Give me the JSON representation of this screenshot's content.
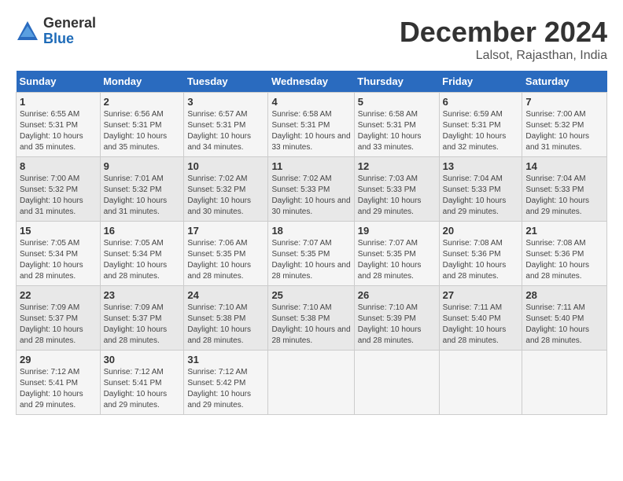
{
  "header": {
    "logo_general": "General",
    "logo_blue": "Blue",
    "month_title": "December 2024",
    "location": "Lalsot, Rajasthan, India"
  },
  "calendar": {
    "days_header": [
      "Sunday",
      "Monday",
      "Tuesday",
      "Wednesday",
      "Thursday",
      "Friday",
      "Saturday"
    ],
    "weeks": [
      [
        null,
        null,
        null,
        null,
        null,
        null,
        null
      ]
    ],
    "cells": [
      {
        "date": 1,
        "sunrise": "6:55 AM",
        "sunset": "5:31 PM",
        "daylight": "10 hours and 35 minutes."
      },
      {
        "date": 2,
        "sunrise": "6:56 AM",
        "sunset": "5:31 PM",
        "daylight": "10 hours and 35 minutes."
      },
      {
        "date": 3,
        "sunrise": "6:57 AM",
        "sunset": "5:31 PM",
        "daylight": "10 hours and 34 minutes."
      },
      {
        "date": 4,
        "sunrise": "6:58 AM",
        "sunset": "5:31 PM",
        "daylight": "10 hours and 33 minutes."
      },
      {
        "date": 5,
        "sunrise": "6:58 AM",
        "sunset": "5:31 PM",
        "daylight": "10 hours and 33 minutes."
      },
      {
        "date": 6,
        "sunrise": "6:59 AM",
        "sunset": "5:31 PM",
        "daylight": "10 hours and 32 minutes."
      },
      {
        "date": 7,
        "sunrise": "7:00 AM",
        "sunset": "5:32 PM",
        "daylight": "10 hours and 31 minutes."
      },
      {
        "date": 8,
        "sunrise": "7:00 AM",
        "sunset": "5:32 PM",
        "daylight": "10 hours and 31 minutes."
      },
      {
        "date": 9,
        "sunrise": "7:01 AM",
        "sunset": "5:32 PM",
        "daylight": "10 hours and 31 minutes."
      },
      {
        "date": 10,
        "sunrise": "7:02 AM",
        "sunset": "5:32 PM",
        "daylight": "10 hours and 30 minutes."
      },
      {
        "date": 11,
        "sunrise": "7:02 AM",
        "sunset": "5:33 PM",
        "daylight": "10 hours and 30 minutes."
      },
      {
        "date": 12,
        "sunrise": "7:03 AM",
        "sunset": "5:33 PM",
        "daylight": "10 hours and 29 minutes."
      },
      {
        "date": 13,
        "sunrise": "7:04 AM",
        "sunset": "5:33 PM",
        "daylight": "10 hours and 29 minutes."
      },
      {
        "date": 14,
        "sunrise": "7:04 AM",
        "sunset": "5:33 PM",
        "daylight": "10 hours and 29 minutes."
      },
      {
        "date": 15,
        "sunrise": "7:05 AM",
        "sunset": "5:34 PM",
        "daylight": "10 hours and 28 minutes."
      },
      {
        "date": 16,
        "sunrise": "7:05 AM",
        "sunset": "5:34 PM",
        "daylight": "10 hours and 28 minutes."
      },
      {
        "date": 17,
        "sunrise": "7:06 AM",
        "sunset": "5:35 PM",
        "daylight": "10 hours and 28 minutes."
      },
      {
        "date": 18,
        "sunrise": "7:07 AM",
        "sunset": "5:35 PM",
        "daylight": "10 hours and 28 minutes."
      },
      {
        "date": 19,
        "sunrise": "7:07 AM",
        "sunset": "5:35 PM",
        "daylight": "10 hours and 28 minutes."
      },
      {
        "date": 20,
        "sunrise": "7:08 AM",
        "sunset": "5:36 PM",
        "daylight": "10 hours and 28 minutes."
      },
      {
        "date": 21,
        "sunrise": "7:08 AM",
        "sunset": "5:36 PM",
        "daylight": "10 hours and 28 minutes."
      },
      {
        "date": 22,
        "sunrise": "7:09 AM",
        "sunset": "5:37 PM",
        "daylight": "10 hours and 28 minutes."
      },
      {
        "date": 23,
        "sunrise": "7:09 AM",
        "sunset": "5:37 PM",
        "daylight": "10 hours and 28 minutes."
      },
      {
        "date": 24,
        "sunrise": "7:10 AM",
        "sunset": "5:38 PM",
        "daylight": "10 hours and 28 minutes."
      },
      {
        "date": 25,
        "sunrise": "7:10 AM",
        "sunset": "5:38 PM",
        "daylight": "10 hours and 28 minutes."
      },
      {
        "date": 26,
        "sunrise": "7:10 AM",
        "sunset": "5:39 PM",
        "daylight": "10 hours and 28 minutes."
      },
      {
        "date": 27,
        "sunrise": "7:11 AM",
        "sunset": "5:40 PM",
        "daylight": "10 hours and 28 minutes."
      },
      {
        "date": 28,
        "sunrise": "7:11 AM",
        "sunset": "5:40 PM",
        "daylight": "10 hours and 28 minutes."
      },
      {
        "date": 29,
        "sunrise": "7:12 AM",
        "sunset": "5:41 PM",
        "daylight": "10 hours and 29 minutes."
      },
      {
        "date": 30,
        "sunrise": "7:12 AM",
        "sunset": "5:41 PM",
        "daylight": "10 hours and 29 minutes."
      },
      {
        "date": 31,
        "sunrise": "7:12 AM",
        "sunset": "5:42 PM",
        "daylight": "10 hours and 29 minutes."
      }
    ]
  }
}
